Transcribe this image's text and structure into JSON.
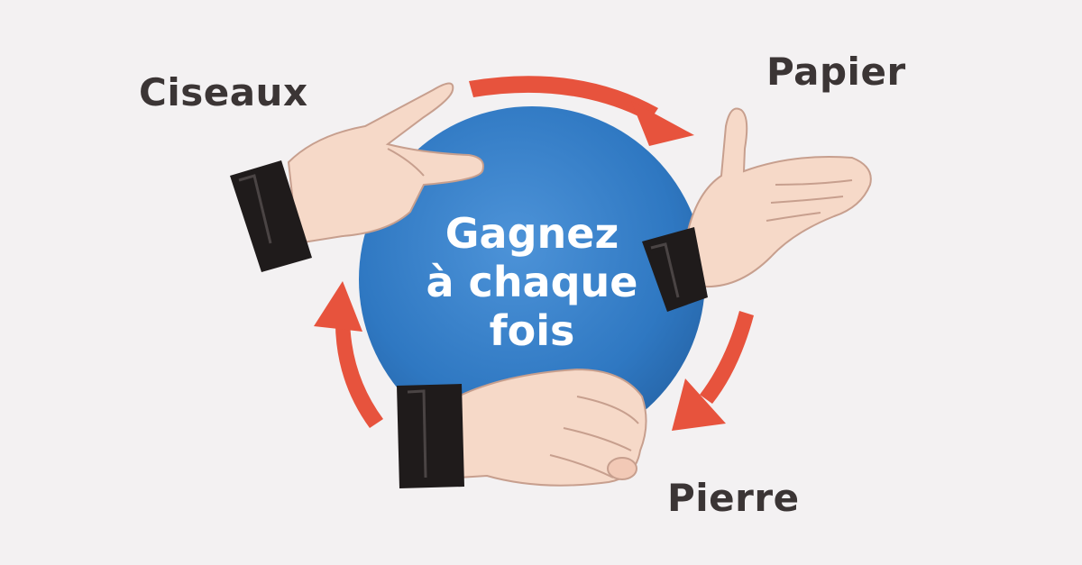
{
  "labels": {
    "scissors": "Ciseaux",
    "paper": "Papier",
    "rock": "Pierre"
  },
  "center": {
    "line1": "Gagnez",
    "line2": "à chaque",
    "line3": "fois"
  },
  "colors": {
    "background": "#f3f1f2",
    "circle": "#2f78c2",
    "arrow": "#e7533d",
    "skin": "#f6d9c8",
    "cuff": "#1f1b1b",
    "label": "#3b3535"
  }
}
